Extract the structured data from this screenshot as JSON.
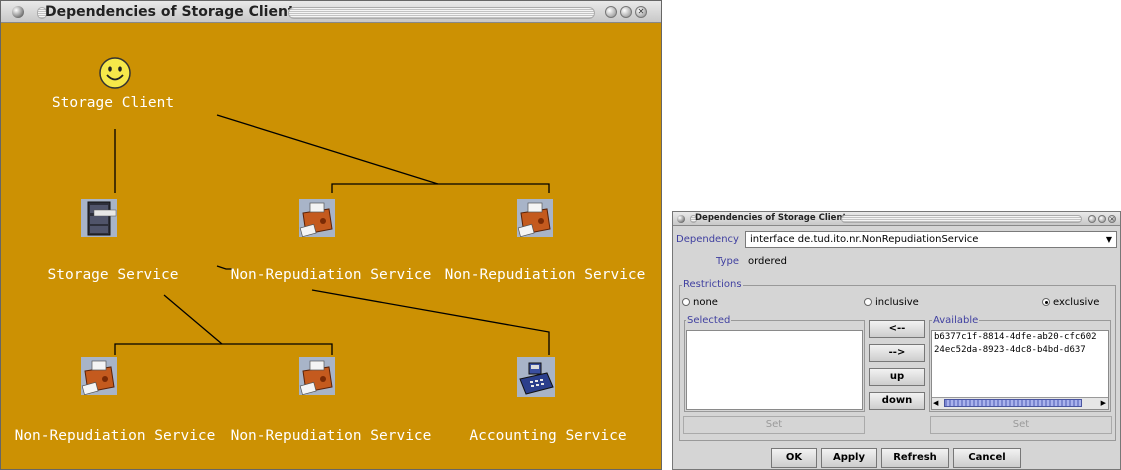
{
  "graph_window": {
    "title": "Dependencies of Storage Client",
    "nodes": [
      {
        "id": "client",
        "label": "Storage Client",
        "icon": "smiley-face-icon"
      },
      {
        "id": "storage",
        "label": "Storage Service",
        "icon": "file-cabinet-icon"
      },
      {
        "id": "nr1",
        "label": "Non-Repudiation Service",
        "icon": "printer-stamp-icon"
      },
      {
        "id": "nr2",
        "label": "Non-Repudiation Service",
        "icon": "printer-stamp-icon"
      },
      {
        "id": "nr3",
        "label": "Non-Repudiation Service",
        "icon": "printer-stamp-icon"
      },
      {
        "id": "nr4",
        "label": "Non-Repudiation Service",
        "icon": "printer-stamp-icon"
      },
      {
        "id": "acct",
        "label": "Accounting Service",
        "icon": "cash-register-icon"
      }
    ],
    "background_color": "#cc9103"
  },
  "dialog": {
    "title": "Dependencies of Storage Client",
    "dependency_label": "Dependency",
    "dependency_value": "interface de.tud.ito.nr.NonRepudiationService",
    "type_label": "Type",
    "type_value": "ordered",
    "restrictions_legend": "Restrictions",
    "radio_none": "none",
    "radio_inclusive": "inclusive",
    "radio_exclusive": "exclusive",
    "selected_option": "exclusive",
    "selected_legend": "Selected",
    "available_legend": "Available",
    "available_items": [
      "b6377c1f-8814-4dfe-ab20-cfc602",
      "24ec52da-8923-4dc8-b4bd-d637"
    ],
    "btn_left": "<--",
    "btn_right": "-->",
    "btn_up": "up",
    "btn_down": "down",
    "set_left": "Set",
    "set_right": "Set",
    "ok": "OK",
    "apply": "Apply",
    "refresh": "Refresh",
    "cancel": "Cancel"
  }
}
